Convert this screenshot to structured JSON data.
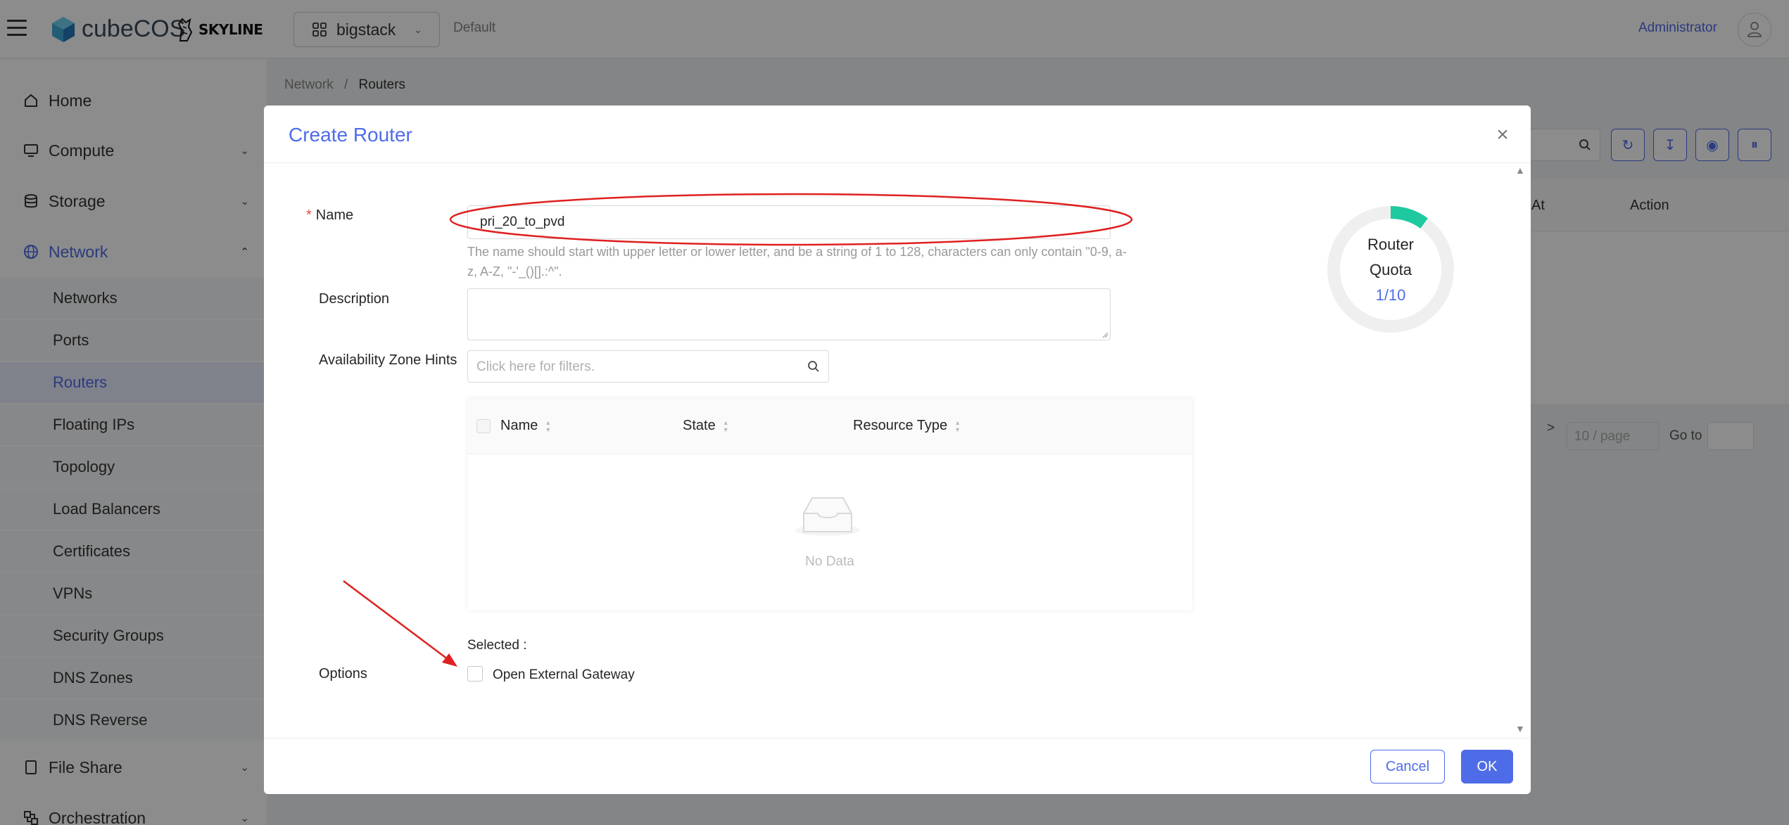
{
  "topbar": {
    "logo_text": "cubeCOS",
    "partner_logo": "SKYLINE",
    "project": "bigstack",
    "domain": "Default",
    "user": "Administrator"
  },
  "sidebar": {
    "items": [
      {
        "label": "Home",
        "icon": "home-icon"
      },
      {
        "label": "Compute",
        "icon": "monitor-icon"
      },
      {
        "label": "Storage",
        "icon": "database-icon"
      },
      {
        "label": "Network",
        "icon": "globe-icon"
      },
      {
        "label": "File Share",
        "icon": "file-icon"
      },
      {
        "label": "Orchestration",
        "icon": "cluster-icon"
      }
    ],
    "network_sub": [
      "Networks",
      "Ports",
      "Routers",
      "Floating IPs",
      "Topology",
      "Load Balancers",
      "Certificates",
      "VPNs",
      "Security Groups",
      "DNS Zones",
      "DNS Reverse"
    ],
    "active": "Routers"
  },
  "breadcrumb": {
    "parent": "Network",
    "separator": "/",
    "current": "Routers"
  },
  "background_table": {
    "col_at": "At",
    "col_action": "Action",
    "page_size": "10 / page",
    "goto_label": "Go to",
    "next": ">"
  },
  "modal": {
    "title": "Create Router",
    "name_label": "Name",
    "name_value": "pri_20_to_pvd",
    "name_help": "The name should start with upper letter or lower letter, and be a string of 1 to 128, characters can only contain \"0-9, a-z, A-Z, \"-'_()[].:^\".",
    "description_label": "Description",
    "description_value": "",
    "az_label": "Availability Zone Hints",
    "filter_placeholder": "Click here for filters.",
    "table_columns": [
      "Name",
      "State",
      "Resource Type"
    ],
    "empty_text": "No Data",
    "selected_label": "Selected :",
    "options_label": "Options",
    "option_external_gateway": "Open External Gateway",
    "quota": {
      "title_line1": "Router",
      "title_line2": "Quota",
      "value": "1/10",
      "used": 1,
      "total": 10,
      "color": "#1fc9a0"
    },
    "cancel": "Cancel",
    "ok": "OK"
  },
  "colors": {
    "primary": "#4f6ce8",
    "annotation": "#e02020"
  }
}
